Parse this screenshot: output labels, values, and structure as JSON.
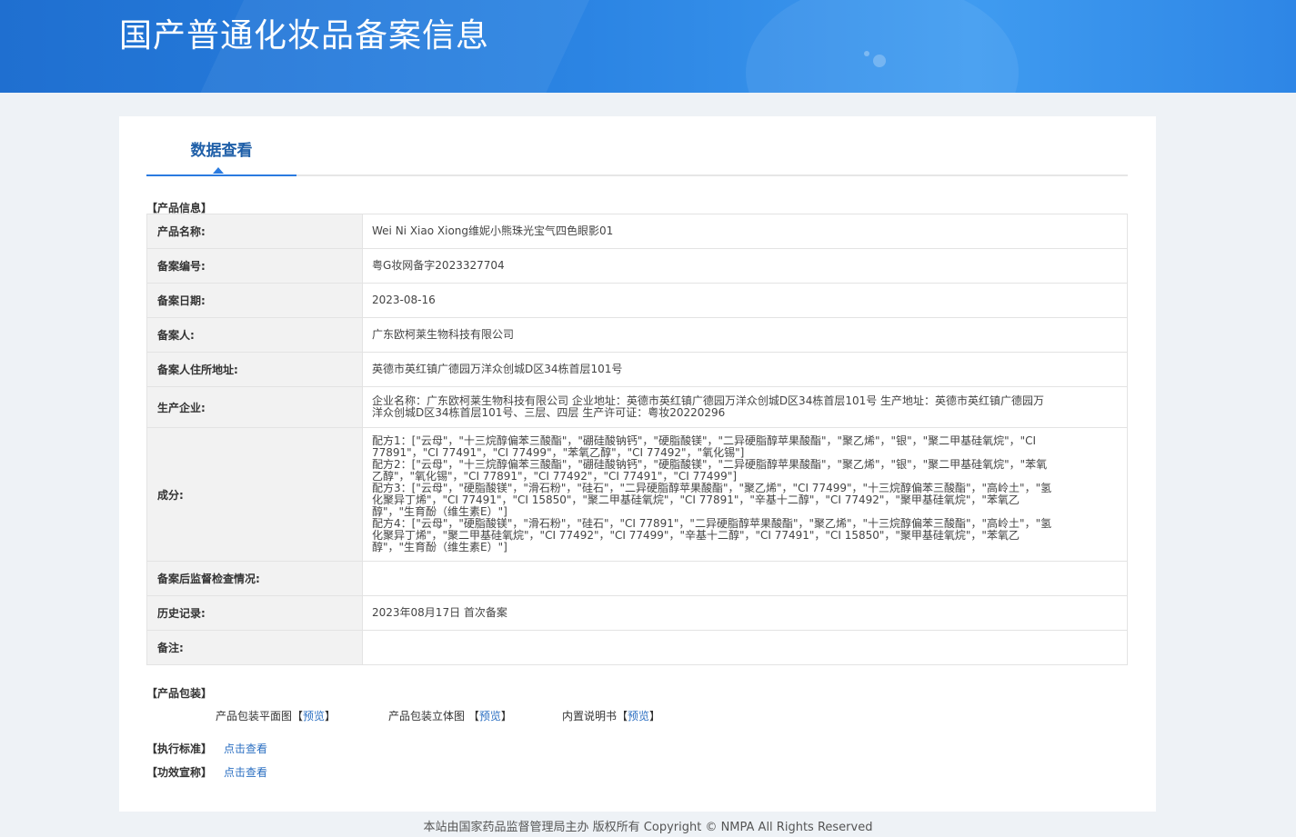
{
  "banner": {
    "title": "国产普通化妆品备案信息"
  },
  "tab": {
    "label": "数据查看"
  },
  "sections": {
    "product_info": "【产品信息】",
    "packaging": "【产品包装】",
    "standard": "【执行标准】",
    "claims": "【功效宣称】"
  },
  "rows": [
    {
      "label": "产品名称:",
      "value": "Wei Ni Xiao Xiong维妮小熊珠光宝气四色眼影01"
    },
    {
      "label": "备案编号:",
      "value": "粤G妆网备字2023327704"
    },
    {
      "label": "备案日期:",
      "value": "2023-08-16"
    },
    {
      "label": "备案人:",
      "value": "广东欧柯莱生物科技有限公司"
    },
    {
      "label": "备案人住所地址:",
      "value": "英德市英红镇广德园万洋众创城D区34栋首层101号"
    },
    {
      "label": "生产企业:",
      "lines": [
        "企业名称：广东欧柯莱生物科技有限公司 企业地址：英德市英红镇广德园万洋众创城D区34栋首层101号 生产地址：英德市英红镇广德园万",
        "洋众创城D区34栋首层101号、三层、四层 生产许可证：粤妆20220296"
      ]
    },
    {
      "label": "成分:",
      "lines": [
        "配方1：[\"云母\"，\"十三烷醇偏苯三酸酯\"，\"硼硅酸钠钙\"，\"硬脂酸镁\"，\"二异硬脂醇苹果酸酯\"，\"聚乙烯\"，\"银\"，\"聚二甲基硅氧烷\"，\"CI",
        "77891\"，\"CI 77491\"，\"CI 77499\"，\"苯氧乙醇\"，\"CI 77492\"，\"氧化锡\"]",
        "配方2：[\"云母\"，\"十三烷醇偏苯三酸酯\"，\"硼硅酸钠钙\"，\"硬脂酸镁\"，\"二异硬脂醇苹果酸酯\"，\"聚乙烯\"，\"银\"，\"聚二甲基硅氧烷\"，\"苯氧",
        "乙醇\"，\"氧化锡\"，\"CI 77891\"，\"CI 77492\"，\"CI 77491\"，\"CI 77499\"]",
        "配方3：[\"云母\"，\"硬脂酸镁\"，\"滑石粉\"，\"硅石\"，\"二异硬脂醇苹果酸酯\"，\"聚乙烯\"，\"CI 77499\"，\"十三烷醇偏苯三酸酯\"，\"高岭土\"，\"氢",
        "化聚异丁烯\"，\"CI 77491\"，\"CI 15850\"，\"聚二甲基硅氧烷\"，\"CI 77891\"，\"辛基十二醇\"，\"CI 77492\"，\"聚甲基硅氧烷\"，\"苯氧乙",
        "醇\"，\"生育酚（维生素E）\"]",
        "配方4：[\"云母\"，\"硬脂酸镁\"，\"滑石粉\"，\"硅石\"，\"CI 77891\"，\"二异硬脂醇苹果酸酯\"，\"聚乙烯\"，\"十三烷醇偏苯三酸酯\"，\"高岭土\"，\"氢",
        "化聚异丁烯\"，\"聚二甲基硅氧烷\"，\"CI 77492\"，\"CI 77499\"，\"辛基十二醇\"，\"CI 77491\"，\"CI 15850\"，\"聚甲基硅氧烷\"，\"苯氧乙",
        "醇\"，\"生育酚（维生素E）\"]"
      ]
    },
    {
      "label": "备案后监督检查情况:",
      "value": ""
    },
    {
      "label": "历史记录:",
      "value": "2023年08月17日 首次备案"
    },
    {
      "label": "备注:",
      "value": ""
    }
  ],
  "packaging": {
    "items": [
      {
        "name": "产品包装平面图",
        "link": "预览"
      },
      {
        "name": "产品包装立体图",
        "link": "预览"
      },
      {
        "name": "内置说明书",
        "link": "预览"
      }
    ]
  },
  "links": {
    "view_text": "点击查看"
  },
  "footer": {
    "text": "本站由国家药品监督管理局主办 版权所有 Copyright © NMPA All Rights Reserved"
  }
}
